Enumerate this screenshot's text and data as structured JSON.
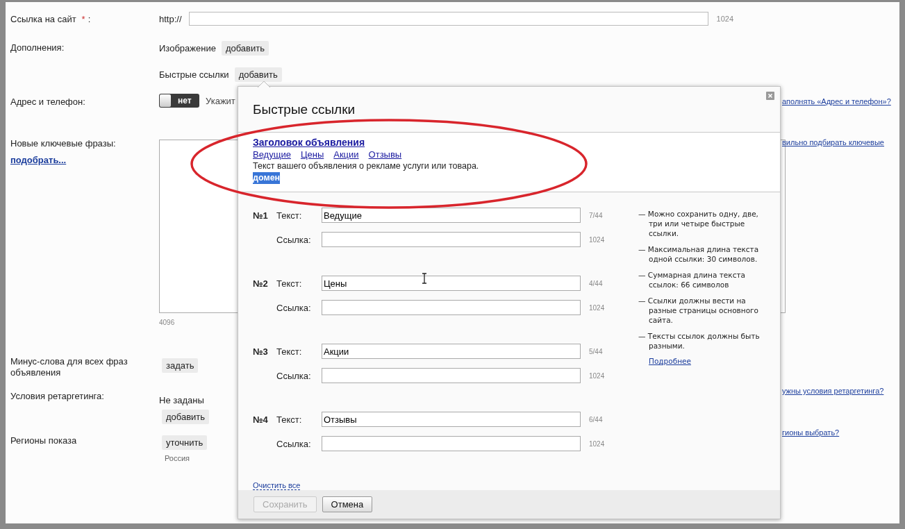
{
  "site_link": {
    "label": "Ссылка на сайт",
    "required_mark": "*",
    "label_end": ":",
    "prefix": "http://",
    "counter": "1024"
  },
  "extras": {
    "label": "Дополнения:",
    "items": [
      {
        "label": "Изображение",
        "button": "добавить"
      },
      {
        "label": "Быстрые ссылки",
        "button": "добавить"
      }
    ]
  },
  "address": {
    "label": "Адрес и телефон:",
    "toggle": {
      "on": false,
      "label": "нет"
    },
    "hint": "Укажит",
    "help_link": "аполнять «Адрес и телефон»?"
  },
  "keywords": {
    "label": "Новые ключевые фразы:",
    "pick_link": "подобрать...",
    "counter": "4096",
    "help_link": "вильно подбирать ключевые"
  },
  "minus_words": {
    "label": "Минус-слова для всех фраз объявления",
    "button": "задать"
  },
  "retargeting": {
    "label": "Условия ретаргетинга:",
    "status": "Не заданы",
    "button": "добавить",
    "help_link": "ужны условия ретаргетинга?"
  },
  "regions": {
    "label": "Регионы показа",
    "button": "уточнить",
    "value": "Россия",
    "help_link": "гионы выбрать?"
  },
  "modal": {
    "title": "Быстрые ссылки",
    "preview": {
      "title": "Заголовок объявления",
      "links": [
        "Ведущие",
        "Цены",
        "Акции",
        "Отзывы"
      ],
      "text": "Текст вашего объявления о рекламе услуги или товара.",
      "domain": "домен",
      "domain_highlighted": true
    },
    "rows": [
      {
        "number": "№1",
        "text_label": "Текст:",
        "text_value": "Ведущие",
        "text_counter": "7/44",
        "link_label": "Ссылка:",
        "link_counter": "1024"
      },
      {
        "number": "№2",
        "text_label": "Текст:",
        "text_value": "Цены",
        "text_counter": "4/44",
        "link_label": "Ссылка:",
        "link_counter": "1024"
      },
      {
        "number": "№3",
        "text_label": "Текст:",
        "text_value": "Акции",
        "text_counter": "5/44",
        "link_label": "Ссылка:",
        "link_counter": "1024"
      },
      {
        "number": "№4",
        "text_label": "Текст:",
        "text_value": "Отзывы",
        "text_counter": "6/44",
        "link_label": "Ссылка:",
        "link_counter": "1024"
      }
    ],
    "notes": [
      "— Можно сохранить одну, две, три или четыре быстрые ссылки.",
      "— Максимальная длина текста одной ссылки: 30 символов.",
      "— Суммарная длина текста ссылок: 66 символов",
      "— Ссылки должны вести на разные страницы основного сайта.",
      "— Тексты ссылок должны быть разными."
    ],
    "more_link": "Подробнее",
    "clear_link": "Очистить все",
    "buttons": [
      {
        "label": "Сохранить",
        "disabled": true
      },
      {
        "label": "Отмена",
        "disabled": false
      }
    ]
  }
}
